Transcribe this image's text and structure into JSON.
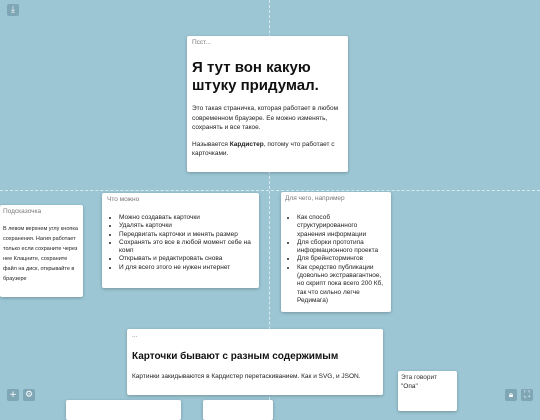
{
  "toolbar": {
    "download_icon": "download-icon",
    "add_icon": "plus-icon",
    "settings_icon": "gear-icon",
    "lock_icon": "lock-icon",
    "fullscreen_icon": "fullscreen-icon"
  },
  "cards": {
    "main": {
      "label": "Псст...",
      "title": "Я тут вон какую штуку придумал.",
      "para1": "Это такая страничка, которая работает в любом современном браузере. Ее можно изменять, сохранять и все такое.",
      "para2_pre": "Называется ",
      "para2_bold": "Кардистер",
      "para2_post": ", потому что работает с карточками."
    },
    "hint": {
      "label": "Подсказочка",
      "text": "В левом верхнем углу кнопка сохранения. Нагия работает только если сохраните через нее Клацните, сохраните файл на диск, открывайте в браузере"
    },
    "can": {
      "label": "Что можно",
      "items": [
        "Можно создавать карточки",
        "Удалять карточки",
        "Передвигать карточки и менять размер",
        "Сохранять это все в любой момент себе на комп",
        "Открывать и редактировать снова",
        "И для всего этого не нужен интернет"
      ]
    },
    "uses": {
      "label": "Для чего, например",
      "items": [
        "Как способ структурированного хранения информации",
        "Для сборки прототипа информационного проекта",
        "Для брейнстормингов",
        "Как средство публикации (довольно экстравагантное, но скрипт пока всего 200 Кб, так что сильно легче Редимага)"
      ]
    },
    "content": {
      "label": "...",
      "title": "Карточки бывают с разным содержимым",
      "text": "Картинки закидываются в Кардистер перетаскиванием. Как и SVG, и JSON."
    },
    "opa": {
      "label": "Эта говорит",
      "text": "\"Опа\""
    }
  }
}
